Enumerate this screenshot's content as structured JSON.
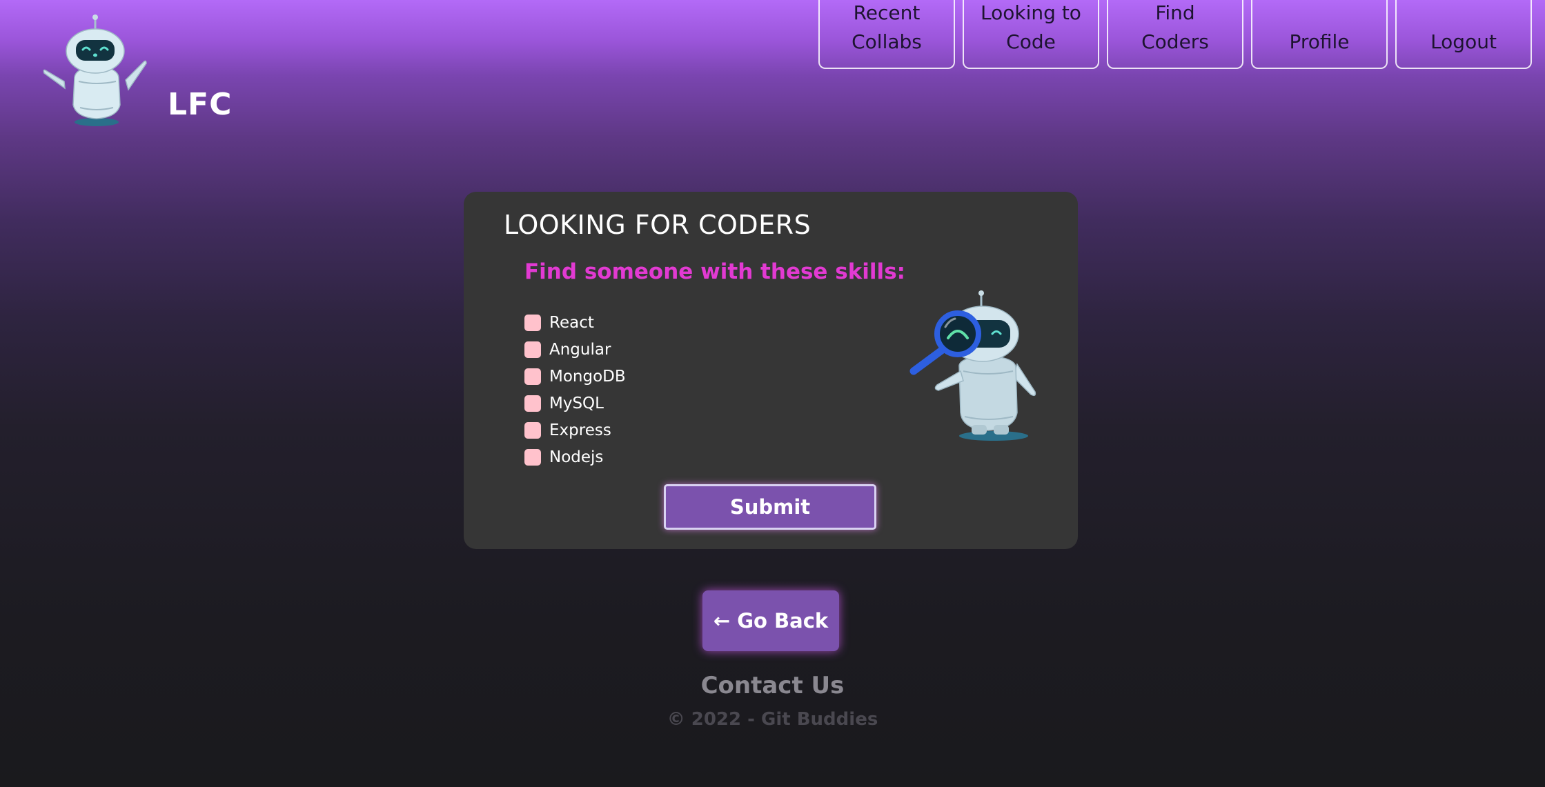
{
  "header": {
    "brand_name": "LFC",
    "logo_icon": "robot-mascot-icon"
  },
  "nav": {
    "items": [
      {
        "label": "Recent\nCollabs"
      },
      {
        "label": "Looking to\nCode"
      },
      {
        "label": "Find\nCoders"
      },
      {
        "label": "Profile"
      },
      {
        "label": "Logout"
      }
    ]
  },
  "card": {
    "title": "LOOKING FOR CODERS",
    "subtitle": "Find someone with these skills:",
    "skills": [
      {
        "label": "React",
        "checked": false
      },
      {
        "label": "Angular",
        "checked": false
      },
      {
        "label": "MongoDB",
        "checked": false
      },
      {
        "label": "MySQL",
        "checked": false
      },
      {
        "label": "Express",
        "checked": false
      },
      {
        "label": "Nodejs",
        "checked": false
      }
    ],
    "robot_icon": "robot-magnifier-icon",
    "submit_label": "Submit"
  },
  "footer": {
    "go_back_label": "← Go Back",
    "contact_label": "Contact Us",
    "copyright": "© 2022 - Git Buddies"
  },
  "colors": {
    "accent_purple": "#7b52ad",
    "subtitle_pink": "#e23ad2",
    "checkbox_pink": "#ffc2cc",
    "card_background": "#363636"
  }
}
